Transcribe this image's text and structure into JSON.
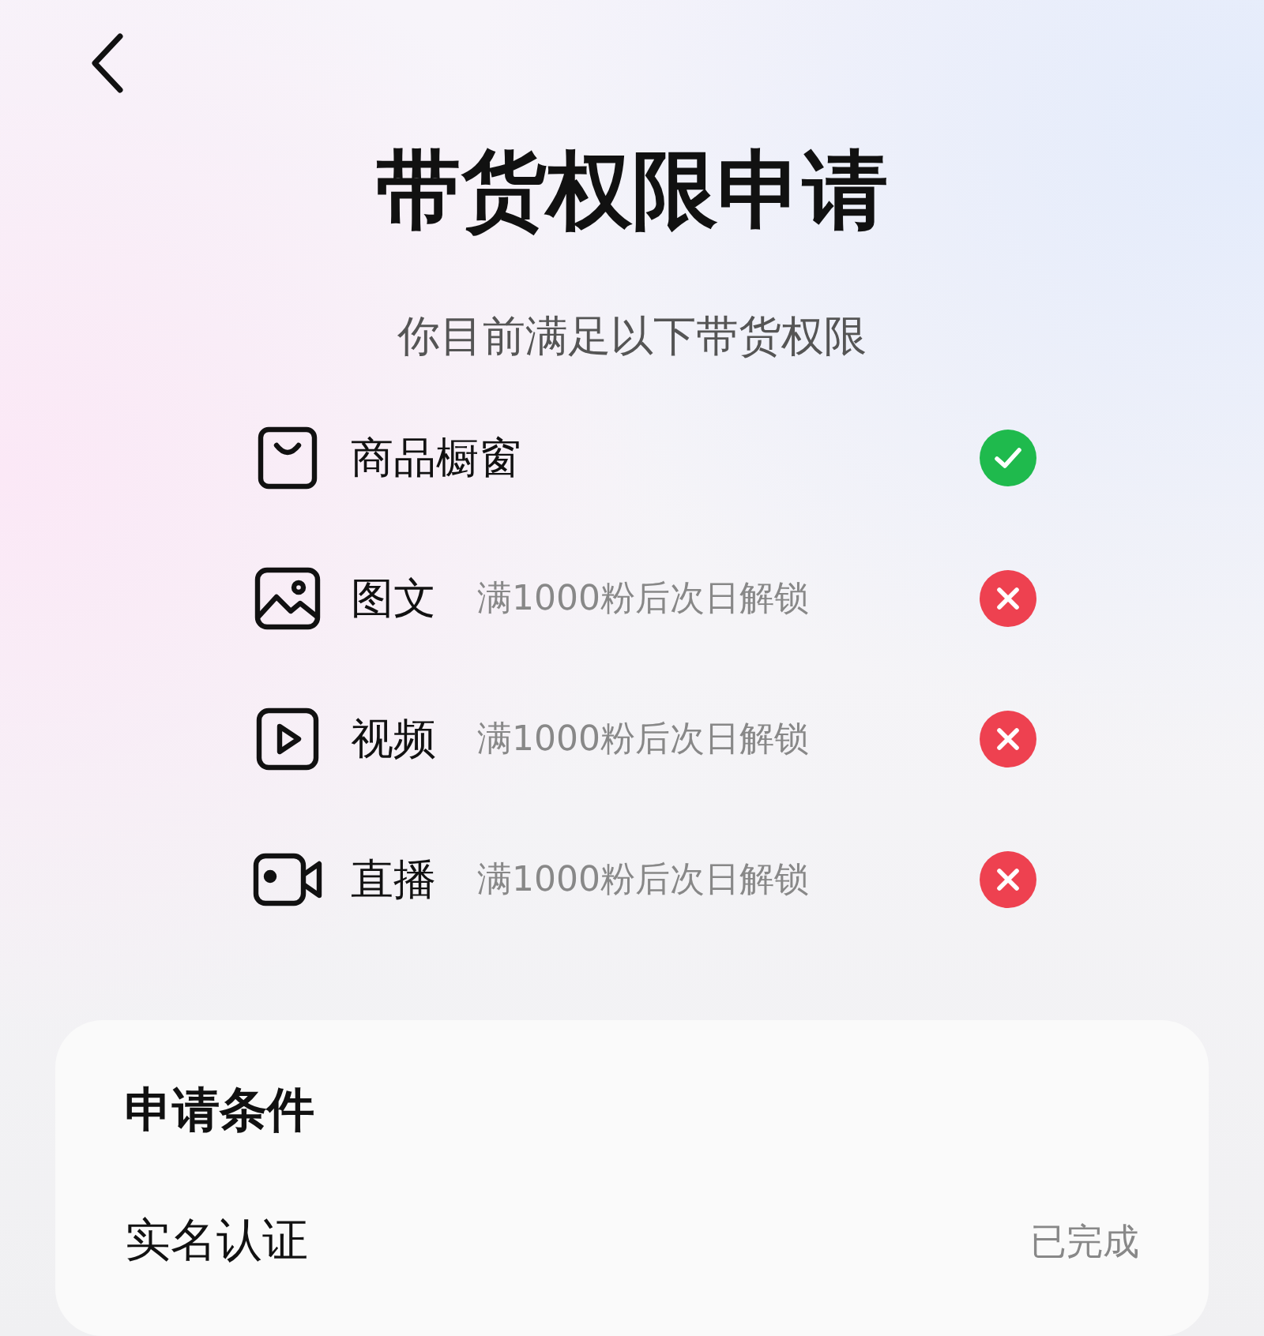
{
  "title": "带货权限申请",
  "subtitle": "你目前满足以下带货权限",
  "permissions": [
    {
      "kind": "bag",
      "label": "商品橱窗",
      "met": true
    },
    {
      "kind": "image",
      "label": "图文",
      "note": "满1000粉后次日解锁",
      "met": false
    },
    {
      "kind": "video",
      "label": "视频",
      "note": "满1000粉后次日解锁",
      "met": false
    },
    {
      "kind": "camera",
      "label": "直播",
      "note": "满1000粉后次日解锁",
      "met": false
    }
  ],
  "conditions": {
    "title": "申请条件",
    "items": [
      {
        "label": "实名认证",
        "status": "已完成"
      }
    ]
  }
}
